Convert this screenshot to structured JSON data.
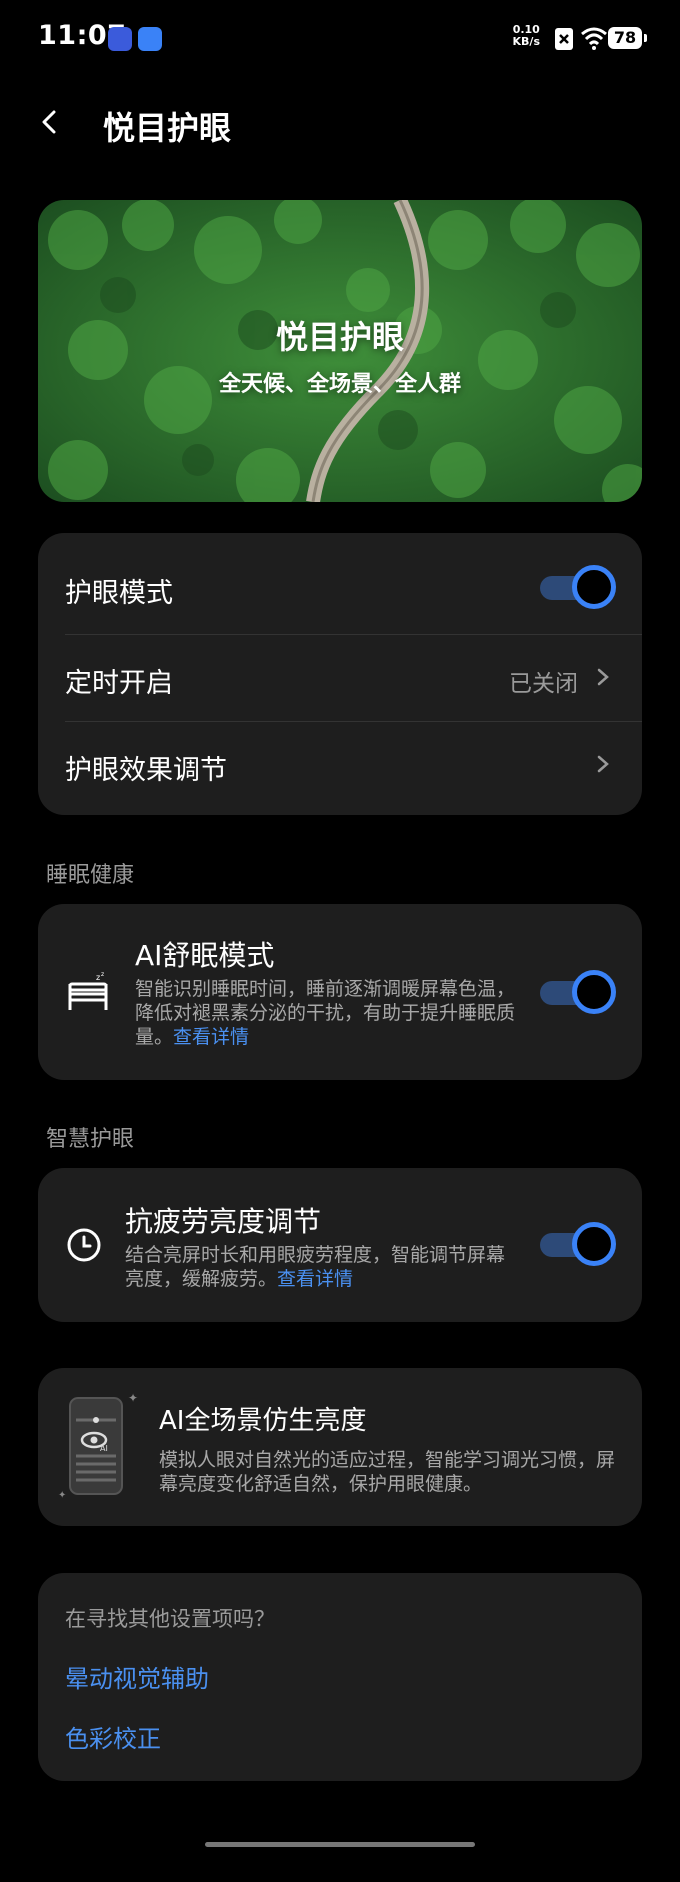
{
  "status_bar": {
    "time": "11:07",
    "network_speed": "0.10",
    "network_unit": "KB/s",
    "battery": "78"
  },
  "header": {
    "title": "悦目护眼"
  },
  "banner": {
    "title": "悦目护眼",
    "subtitle": "全天候、全场景、全人群"
  },
  "eye_care_card": {
    "mode_label": "护眼模式",
    "mode_enabled": true,
    "schedule_label": "定时开启",
    "schedule_value": "已关闭",
    "effect_label": "护眼效果调节"
  },
  "sleep_section": {
    "label": "睡眠健康",
    "title": "AI舒眠模式",
    "desc": "智能识别睡眠时间，睡前逐渐调暖屏幕色温，降低对褪黑素分泌的干扰，有助于提升睡眠质量。",
    "link": "查看详情",
    "enabled": true
  },
  "smart_section": {
    "label": "智慧护眼",
    "title": "抗疲劳亮度调节",
    "desc": "结合亮屏时长和用眼疲劳程度，智能调节屏幕亮度，缓解疲劳。",
    "link": "查看详情",
    "enabled": true
  },
  "ai_brightness": {
    "title": "AI全场景仿生亮度",
    "desc": "模拟人眼对自然光的适应过程，智能学习调光习惯，屏幕亮度变化舒适自然，保护用眼健康。"
  },
  "other_settings": {
    "prompt": "在寻找其他设置项吗？",
    "link1": "晕动视觉辅助",
    "link2": "色彩校正"
  },
  "colors": {
    "accent": "#3a82f7",
    "link": "#4a90f0",
    "card": "#1e1e1e",
    "background": "#000000"
  }
}
